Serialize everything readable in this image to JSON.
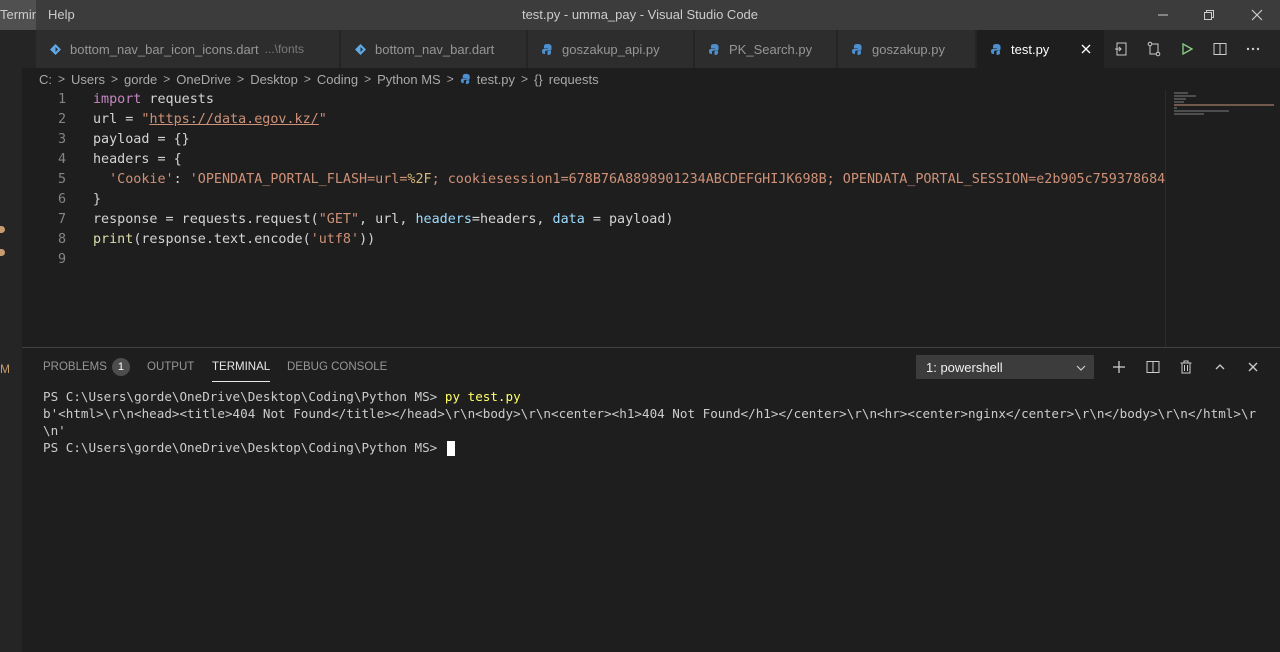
{
  "titlebar": {
    "menu_terminal": "Terminal",
    "menu_help": "Help",
    "window_title": "test.py - umma_pay - Visual Studio Code"
  },
  "tabs": [
    {
      "label": "bottom_nav_bar_icon_icons.dart",
      "desc": "...\\fonts",
      "icon": "dart-icon"
    },
    {
      "label": "bottom_nav_bar.dart",
      "desc": "",
      "icon": "dart-icon"
    },
    {
      "label": "goszakup_api.py",
      "desc": "",
      "icon": "python-icon"
    },
    {
      "label": "PK_Search.py",
      "desc": "",
      "icon": "python-icon"
    },
    {
      "label": "goszakup.py",
      "desc": "",
      "icon": "python-icon"
    },
    {
      "label": "test.py",
      "desc": "",
      "icon": "python-icon",
      "active": true
    }
  ],
  "breadcrumb": {
    "parts": [
      "C:",
      "Users",
      "gorde",
      "OneDrive",
      "Desktop",
      "Coding",
      "Python MS"
    ],
    "file": "test.py",
    "symbol": "requests"
  },
  "editor": {
    "line_numbers": [
      "1",
      "2",
      "3",
      "4",
      "5",
      "6",
      "7",
      "8",
      "9"
    ],
    "lines": {
      "l1_kw": "import",
      "l1_rest": " requests",
      "l2_a": "url = ",
      "l2_q1": "\"",
      "l2_url": "https://data.egov.kz/",
      "l2_q2": "\"",
      "l3": "payload = {}",
      "l4": "headers = {",
      "l5_key": "'Cookie'",
      "l5_colon": ": ",
      "l5_val_a": "'OPENDATA_PORTAL_FLASH=url=",
      "l5_esc": "%2F",
      "l5_val_b": "; cookiesession1=678B76A8898901234ABCDEFGHIJK698B; OPENDATA_PORTAL_SESSION=e2b905c759378684",
      "l6": "}",
      "l7_a": "response = requests.request(",
      "l7_get": "\"GET\"",
      "l7_b": ", url, ",
      "l7_p1": "headers",
      "l7_c": "=headers, ",
      "l7_p2": "data",
      "l7_d": " = payload)",
      "l8_fn": "print",
      "l8_a": "(response.text.encode(",
      "l8_str": "'utf8'",
      "l8_b": "))"
    }
  },
  "panel": {
    "tabs": {
      "problems": "PROBLEMS",
      "problems_count": "1",
      "output": "OUTPUT",
      "terminal": "TERMINAL",
      "debug": "DEBUG CONSOLE"
    },
    "terminal_select": "1: powershell",
    "terminal_lines": {
      "prompt1": "PS C:\\Users\\gorde\\OneDrive\\Desktop\\Coding\\Python MS> ",
      "cmd1": "py test.py",
      "out1": "b'<html>\\r\\n<head><title>404 Not Found</title></head>\\r\\n<body>\\r\\n<center><h1>404 Not Found</h1></center>\\r\\n<hr><center>nginx</center>\\r\\n</body>\\r\\n</html>\\r",
      "out2": "\\n'",
      "prompt2": "PS C:\\Users\\gorde\\OneDrive\\Desktop\\Coding\\Python MS> "
    }
  },
  "colors": {
    "accent_dart": "#5ea9e6",
    "accent_python": "#4d8fcf",
    "run_green": "#89d185"
  }
}
